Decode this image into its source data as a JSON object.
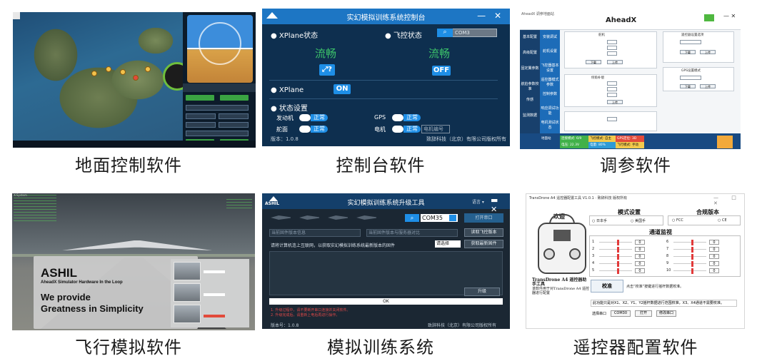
{
  "captions": {
    "ground_control": "地面控制软件",
    "console": "控制台软件",
    "tuning": "调参软件",
    "flight_sim": "飞行模拟软件",
    "training": "模拟训练系统",
    "rc_config": "遥控器配置软件"
  },
  "console": {
    "title": "实幻模拟训练系统控制台",
    "window_controls": "— ✕",
    "xplane_status_label": "XPlane状态",
    "fc_status_label": "飞控状态",
    "com_value": "COM3",
    "xplane_status_value": "流畅",
    "fc_status_value": "流畅",
    "link_button": "⤢?",
    "off_button": "OFF",
    "xplane_label": "XPlane",
    "on_button": "ON",
    "status_settings": "状态设置",
    "engine_label": "发动机",
    "engine_state": "正常",
    "gps_label": "GPS",
    "gps_state": "正常",
    "airframe_label": "舵面",
    "airframe_state": "正常",
    "motor_label": "电机",
    "motor_state": "正常",
    "motor_no_placeholder": "电机编号",
    "version": "版本：1.0.8",
    "company": "致辞科技（北京）有限公司版权所有"
  },
  "tuning": {
    "app_title": "AheadX 调参地面站",
    "brand": "AheadX",
    "sidebar": [
      "基本配置",
      "高级配置",
      "固定翼参数",
      "航拍参数校准",
      "传感",
      "监测数据"
    ],
    "tabs": [
      "安装调试",
      "舵机设置",
      "飞控器基本设置",
      "遥控器模式参数",
      "控制参数",
      "响应调试功能",
      "电机测试状态"
    ],
    "section_titles": [
      "舵机",
      "遥控器设置选项",
      "倾角补偿",
      "GPS设置模式"
    ],
    "button_read": "下载",
    "button_write": "上传",
    "status": [
      "地面站",
      "连接模式: 6/9",
      "飞控模式: 自主",
      "GPS定位: 3D",
      "电压: 22.3V",
      "电量: 80%",
      "飞行模式: 手动"
    ]
  },
  "flight_sim": {
    "window_label": "X-System",
    "brand": "ASHIL",
    "tagline": "AheadX Simulator Hardware In the Loop",
    "line1": "We provide",
    "line2": "Greatness in Simplicity"
  },
  "training": {
    "logo": "ASHIL",
    "title": "实幻模拟训练系统升级工具",
    "lang": "语言 ▾",
    "window_controls": "▬ ✕",
    "com_value": "COM35",
    "open_port": "打开串口",
    "version_placeholder": "当前固件版本信息",
    "latest_placeholder": "当前固件版本与服务器对比",
    "fetch_fc_button": "读取飞控版本",
    "message": "请将计算机连上互联网，以获取实幻模拟训练系统最新版本的固件",
    "select_value": "请选择",
    "get_latest_button": "获取最新固件",
    "upgrade_button": "升级",
    "progress_text": "OK",
    "note1": "1. 升级过程中，请不要断开串口连接并关闭软件。",
    "note2": "2. 升级完成后，请重新上电后再进行操作。",
    "version": "版本号：1.0.8",
    "company": "致辞科技（北京）有限公司版权所有"
  },
  "rc_config": {
    "window_title": "TransDrone A4 遥控器配置工具 V1.0.1 · 致辞科技 版权所有",
    "window_controls": "— □ ✕",
    "welcome": "欢迎",
    "mode_title": "模式设置",
    "mode_left": "日本手",
    "mode_right": "美国手",
    "protocol_title": "合规版本",
    "protocol_left": "FCC",
    "protocol_right": "CE",
    "channel_title": "通道监视",
    "channels_left": [
      "1",
      "2",
      "3",
      "4",
      "5"
    ],
    "channels_right": [
      "6",
      "7",
      "8",
      "9",
      "10"
    ],
    "channel_values": [
      "0",
      "0",
      "0",
      "0",
      "0",
      "0",
      "0",
      "0",
      "0",
      "0"
    ],
    "desc_title": "TransDrone A4 遥控器助手工具",
    "desc_body": "该软件用于对TransDrone A4 遥控器进行配置",
    "calibrate": "校准",
    "calibrate_msg": "点击“校准”按键进行摇杆数据校准。",
    "instruction": "此功能只是对X1、X2、Y1、Y2摇杆数据进行范围校准，X3、X4通道不需要校准。",
    "port_label": "选择串口",
    "port_value": "COM30",
    "open_button": "打开",
    "close_button": "修改串口"
  }
}
